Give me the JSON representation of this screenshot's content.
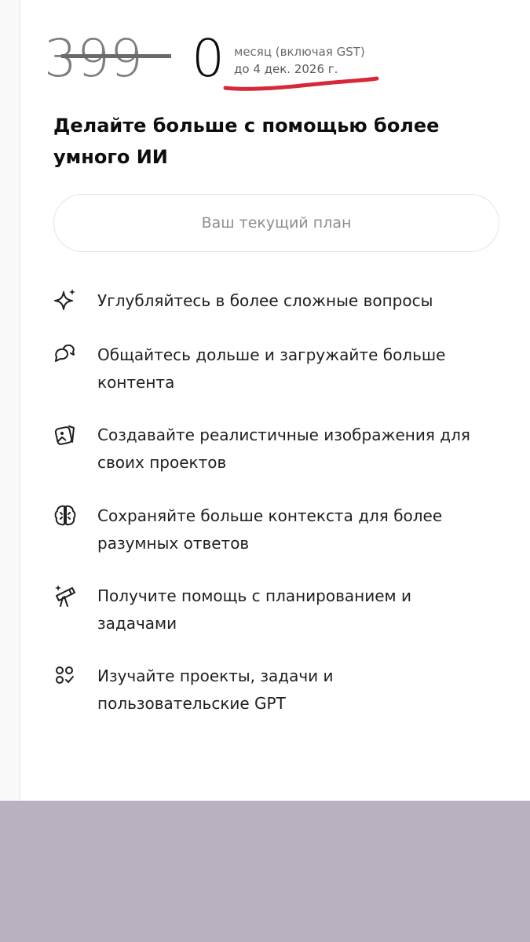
{
  "pricing": {
    "old_price": "399",
    "new_price": "0",
    "period_label": "месяц (включая GST)",
    "valid_until": "до 4 дек. 2026 г."
  },
  "headline": "Делайте больше с помощью более умного ИИ",
  "current_plan_button": "Ваш текущий план",
  "features": [
    {
      "icon": "sparkles-icon",
      "text": "Углубляйтесь в более сложные вопросы"
    },
    {
      "icon": "chat-bubbles-icon",
      "text": "Общайтесь дольше и загружайте больше контента"
    },
    {
      "icon": "image-icon",
      "text": "Создавайте реалистичные изображения для своих проектов"
    },
    {
      "icon": "brain-icon",
      "text": "Сохраняйте больше контекста для более разумных ответов"
    },
    {
      "icon": "telescope-icon",
      "text": "Получите помощь с планированием и задачами"
    },
    {
      "icon": "apps-icon",
      "text": "Изучайте проекты, задачи и пользовательские GPT"
    }
  ],
  "colors": {
    "underline_annotation": "#d7283a",
    "bottom_bar": "#b9b1c0"
  }
}
